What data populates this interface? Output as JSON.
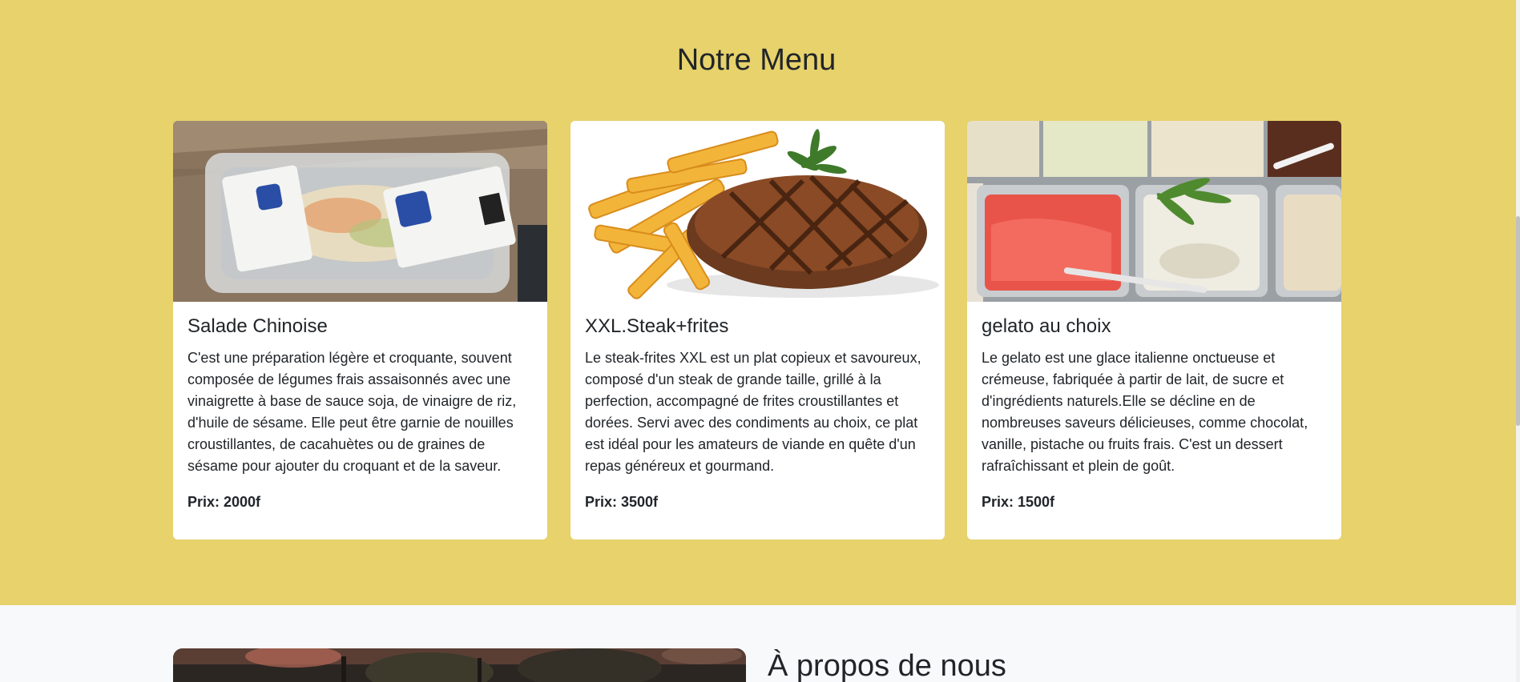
{
  "menu": {
    "title": "Notre Menu",
    "background_color": "#e7d26b",
    "items": [
      {
        "title": "Salade Chinoise",
        "description": "C'est une préparation légère et croquante, souvent composée de légumes frais assaisonnés avec une vinaigrette à base de sauce soja, de vinaigre de riz, d'huile de sésame. Elle peut être garnie de nouilles croustillantes, de cacahuètes ou de graines de sésame pour ajouter du croquant et de la saveur.",
        "price": "Prix: 2000f",
        "image": "salad-container-photo"
      },
      {
        "title": "XXL.Steak+frites",
        "description": "Le steak-frites XXL est un plat copieux et savoureux, composé d'un steak de grande taille, grillé à la perfection, accompagné de frites croustillantes et dorées. Servi avec des condiments au choix, ce plat est idéal pour les amateurs de viande en quête d'un repas généreux et gourmand.",
        "price": "Prix: 3500f",
        "image": "steak-fries-photo"
      },
      {
        "title": "gelato au choix",
        "description": "Le gelato est une glace italienne onctueuse et crémeuse, fabriquée à partir de lait, de sucre et d'ingrédients naturels.Elle se décline en de nombreuses saveurs délicieuses, comme chocolat, vanille, pistache ou fruits frais. C'est un dessert rafraîchissant et plein de goût.",
        "price": "Prix: 1500f",
        "image": "gelato-display-photo"
      }
    ]
  },
  "about": {
    "title": "À propos de nous",
    "image": "restaurant-exterior-photo"
  }
}
